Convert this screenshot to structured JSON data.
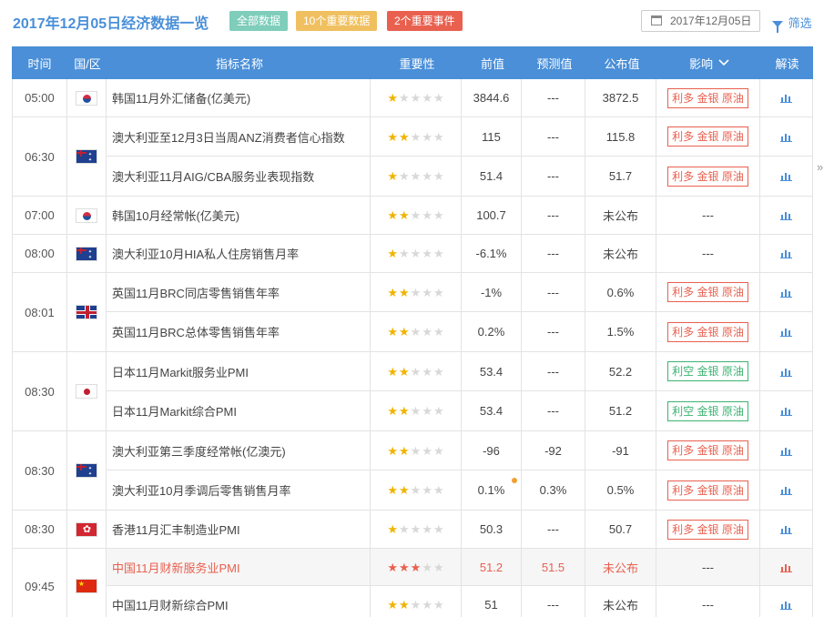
{
  "header": {
    "title": "2017年12月05日经济数据一览",
    "tags": {
      "all": "全部数据",
      "ten": "10个重要数据",
      "two": "2个重要事件"
    },
    "date": "2017年12月05日",
    "filter": "筛选"
  },
  "columns": {
    "time": "时间",
    "country": "国/区",
    "name": "指标名称",
    "importance": "重要性",
    "previous": "前值",
    "forecast": "预测值",
    "published": "公布值",
    "effect": "影响",
    "analysis": "解读"
  },
  "colors": {
    "accent": "#4a8fd8",
    "bullish": "#e9604f",
    "bearish": "#3cb371",
    "star": "#f0b400"
  },
  "groups": [
    {
      "time": "05:00",
      "flag": "kr",
      "rows": [
        {
          "name": "韩国11月外汇储备(亿美元)",
          "stars": 1,
          "prev": "3844.6",
          "fore": "---",
          "pub": "3872.5",
          "effect": "利多 金银 原油",
          "effect_color": "red"
        }
      ]
    },
    {
      "time": "06:30",
      "flag": "au",
      "rows": [
        {
          "name": "澳大利亚至12月3日当周ANZ消费者信心指数",
          "stars": 2,
          "prev": "115",
          "fore": "---",
          "pub": "115.8",
          "effect": "利多 金银 原油",
          "effect_color": "red"
        },
        {
          "name": "澳大利亚11月AIG/CBA服务业表现指数",
          "stars": 1,
          "prev": "51.4",
          "fore": "---",
          "pub": "51.7",
          "effect": "利多 金银 原油",
          "effect_color": "red"
        }
      ]
    },
    {
      "time": "07:00",
      "flag": "kr",
      "rows": [
        {
          "name": "韩国10月经常帐(亿美元)",
          "stars": 2,
          "prev": "100.7",
          "fore": "---",
          "pub": "未公布",
          "effect": "---",
          "effect_color": "none"
        }
      ]
    },
    {
      "time": "08:00",
      "flag": "au",
      "rows": [
        {
          "name": "澳大利亚10月HIA私人住房销售月率",
          "stars": 1,
          "prev": "-6.1%",
          "fore": "---",
          "pub": "未公布",
          "effect": "---",
          "effect_color": "none"
        }
      ]
    },
    {
      "time": "08:01",
      "flag": "gb",
      "rows": [
        {
          "name": "英国11月BRC同店零售销售年率",
          "stars": 2,
          "prev": "-1%",
          "fore": "---",
          "pub": "0.6%",
          "effect": "利多 金银 原油",
          "effect_color": "red"
        },
        {
          "name": "英国11月BRC总体零售销售年率",
          "stars": 2,
          "prev": "0.2%",
          "fore": "---",
          "pub": "1.5%",
          "effect": "利多 金银 原油",
          "effect_color": "red"
        }
      ]
    },
    {
      "time": "08:30",
      "flag": "jp",
      "rows": [
        {
          "name": "日本11月Markit服务业PMI",
          "stars": 2,
          "prev": "53.4",
          "fore": "---",
          "pub": "52.2",
          "effect": "利空 金银 原油",
          "effect_color": "green"
        },
        {
          "name": "日本11月Markit综合PMI",
          "stars": 2,
          "prev": "53.4",
          "fore": "---",
          "pub": "51.2",
          "effect": "利空 金银 原油",
          "effect_color": "green"
        }
      ]
    },
    {
      "time": "08:30",
      "flag": "au",
      "rows": [
        {
          "name": "澳大利亚第三季度经常帐(亿澳元)",
          "stars": 2,
          "prev": "-96",
          "fore": "-92",
          "pub": "-91",
          "effect": "利多 金银 原油",
          "effect_color": "red"
        },
        {
          "name": "澳大利亚10月季调后零售销售月率",
          "stars": 2,
          "prev": "0.1%",
          "fore": "0.3%",
          "pub": "0.5%",
          "effect": "利多 金银 原油",
          "effect_color": "red",
          "dot": true
        }
      ]
    },
    {
      "time": "08:30",
      "flag": "hk",
      "rows": [
        {
          "name": "香港11月汇丰制造业PMI",
          "stars": 1,
          "prev": "50.3",
          "fore": "---",
          "pub": "50.7",
          "effect": "利多 金银 原油",
          "effect_color": "red"
        }
      ]
    },
    {
      "time": "09:45",
      "flag": "cn",
      "rows": [
        {
          "name": "中国11月财新服务业PMI",
          "stars": 3,
          "prev": "51.2",
          "fore": "51.5",
          "pub": "未公布",
          "effect": "---",
          "effect_color": "none",
          "highlight": true
        },
        {
          "name": "中国11月财新综合PMI",
          "stars": 2,
          "prev": "51",
          "fore": "---",
          "pub": "未公布",
          "effect": "---",
          "effect_color": "none"
        }
      ]
    }
  ]
}
